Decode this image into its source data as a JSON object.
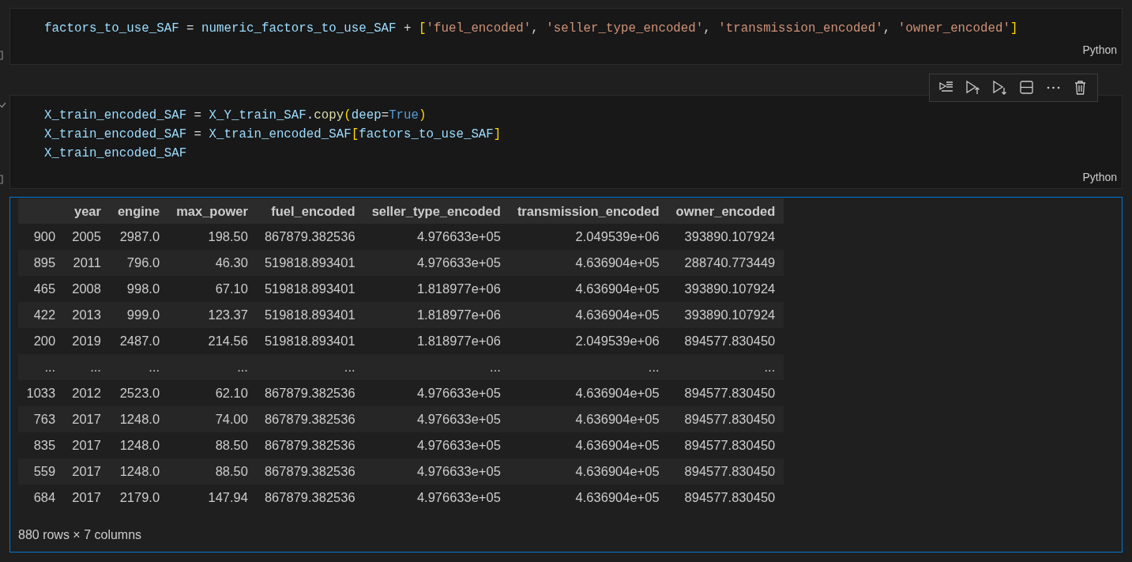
{
  "cells": [
    {
      "lines": [
        [
          {
            "t": "factors_to_use_SAF",
            "kind": "var"
          },
          {
            "t": " = ",
            "kind": "op"
          },
          {
            "t": "numeric_factors_to_use_SAF",
            "kind": "var"
          },
          {
            "t": " + ",
            "kind": "op"
          },
          {
            "t": "[",
            "kind": "bracket"
          },
          {
            "t": "'fuel_encoded'",
            "kind": "str"
          },
          {
            "t": ", ",
            "kind": "op"
          },
          {
            "t": "'seller_type_encoded'",
            "kind": "str"
          },
          {
            "t": ", ",
            "kind": "op"
          },
          {
            "t": "'transmission_encoded'",
            "kind": "str"
          },
          {
            "t": ", ",
            "kind": "op"
          },
          {
            "t": "'owner_encoded'",
            "kind": "str"
          },
          {
            "t": "]",
            "kind": "bracket"
          }
        ]
      ],
      "language": "Python",
      "executed": false,
      "toolbar": false
    },
    {
      "lines": [
        [
          {
            "t": "X_train_encoded_SAF",
            "kind": "var"
          },
          {
            "t": " = ",
            "kind": "op"
          },
          {
            "t": "X_Y_train_SAF",
            "kind": "var"
          },
          {
            "t": ".",
            "kind": "op"
          },
          {
            "t": "copy",
            "kind": "func"
          },
          {
            "t": "(",
            "kind": "bracket"
          },
          {
            "t": "deep",
            "kind": "var"
          },
          {
            "t": "=",
            "kind": "op"
          },
          {
            "t": "True",
            "kind": "keyword"
          },
          {
            "t": ")",
            "kind": "bracket"
          }
        ],
        [
          {
            "t": "X_train_encoded_SAF",
            "kind": "var"
          },
          {
            "t": " = ",
            "kind": "op"
          },
          {
            "t": "X_train_encoded_SAF",
            "kind": "var"
          },
          {
            "t": "[",
            "kind": "bracket"
          },
          {
            "t": "factors_to_use_SAF",
            "kind": "var"
          },
          {
            "t": "]",
            "kind": "bracket"
          }
        ],
        [
          {
            "t": "X_train_encoded_SAF",
            "kind": "var"
          }
        ]
      ],
      "language": "Python",
      "executed": true,
      "toolbar": true
    }
  ],
  "output": {
    "table": {
      "columns": [
        "",
        "year",
        "engine",
        "max_power",
        "fuel_encoded",
        "seller_type_encoded",
        "transmission_encoded",
        "owner_encoded"
      ],
      "rows": [
        [
          "900",
          "2005",
          "2987.0",
          "198.50",
          "867879.382536",
          "4.976633e+05",
          "2.049539e+06",
          "393890.107924"
        ],
        [
          "895",
          "2011",
          "796.0",
          "46.30",
          "519818.893401",
          "4.976633e+05",
          "4.636904e+05",
          "288740.773449"
        ],
        [
          "465",
          "2008",
          "998.0",
          "67.10",
          "519818.893401",
          "1.818977e+06",
          "4.636904e+05",
          "393890.107924"
        ],
        [
          "422",
          "2013",
          "999.0",
          "123.37",
          "519818.893401",
          "1.818977e+06",
          "4.636904e+05",
          "393890.107924"
        ],
        [
          "200",
          "2019",
          "2487.0",
          "214.56",
          "519818.893401",
          "1.818977e+06",
          "2.049539e+06",
          "894577.830450"
        ],
        [
          "...",
          "...",
          "...",
          "...",
          "...",
          "...",
          "...",
          "..."
        ],
        [
          "1033",
          "2012",
          "2523.0",
          "62.10",
          "867879.382536",
          "4.976633e+05",
          "4.636904e+05",
          "894577.830450"
        ],
        [
          "763",
          "2017",
          "1248.0",
          "74.00",
          "867879.382536",
          "4.976633e+05",
          "4.636904e+05",
          "894577.830450"
        ],
        [
          "835",
          "2017",
          "1248.0",
          "88.50",
          "867879.382536",
          "4.976633e+05",
          "4.636904e+05",
          "894577.830450"
        ],
        [
          "559",
          "2017",
          "1248.0",
          "88.50",
          "867879.382536",
          "4.976633e+05",
          "4.636904e+05",
          "894577.830450"
        ],
        [
          "684",
          "2017",
          "2179.0",
          "147.94",
          "867879.382536",
          "4.976633e+05",
          "4.636904e+05",
          "894577.830450"
        ]
      ]
    },
    "summary": "880 rows × 7 columns"
  }
}
